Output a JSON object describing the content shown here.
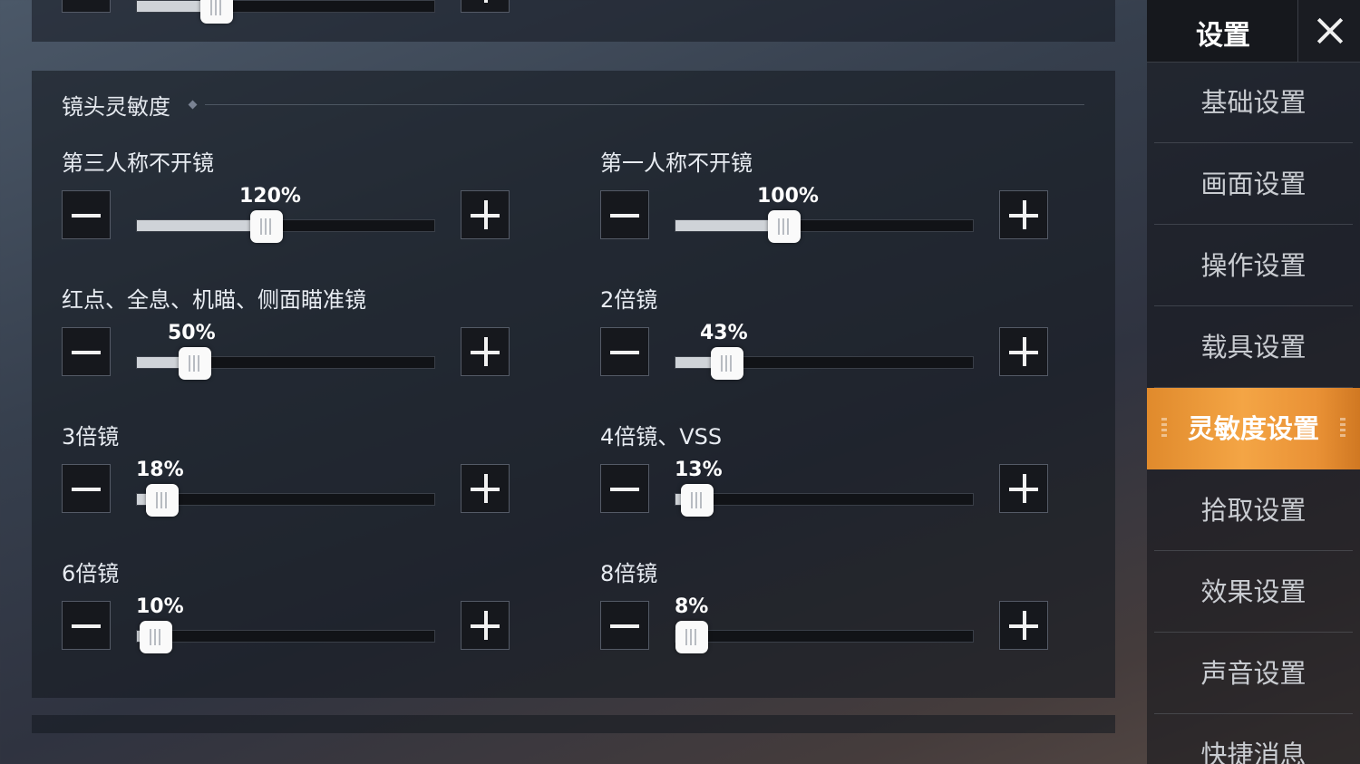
{
  "sidebar": {
    "title": "设置",
    "items": [
      {
        "label": "基础设置",
        "active": false
      },
      {
        "label": "画面设置",
        "active": false
      },
      {
        "label": "操作设置",
        "active": false
      },
      {
        "label": "载具设置",
        "active": false
      },
      {
        "label": "灵敏度设置",
        "active": true
      },
      {
        "label": "拾取设置",
        "active": false
      },
      {
        "label": "效果设置",
        "active": false
      },
      {
        "label": "声音设置",
        "active": false
      },
      {
        "label": "快捷消息",
        "active": false
      }
    ]
  },
  "section": {
    "title": "镜头灵敏度"
  },
  "sliders": [
    {
      "label": "第三人称不开镜",
      "value_text": "120%",
      "fraction": 0.4
    },
    {
      "label": "第一人称不开镜",
      "value_text": "100%",
      "fraction": 0.33
    },
    {
      "label": "红点、全息、机瞄、侧面瞄准镜",
      "value_text": "50%",
      "fraction": 0.16
    },
    {
      "label": "2倍镜",
      "value_text": "43%",
      "fraction": 0.14
    },
    {
      "label": "3倍镜",
      "value_text": "18%",
      "fraction": 0.05
    },
    {
      "label": "4倍镜、VSS",
      "value_text": "13%",
      "fraction": 0.04
    },
    {
      "label": "6倍镜",
      "value_text": "10%",
      "fraction": 0.03
    },
    {
      "label": "8倍镜",
      "value_text": "8%",
      "fraction": 0.02
    }
  ],
  "top_partial_slider": {
    "fraction": 0.27
  },
  "colors": {
    "accent": "#f4a545",
    "button_bg": "#16181d",
    "track_fill": "#cfd3d8"
  }
}
